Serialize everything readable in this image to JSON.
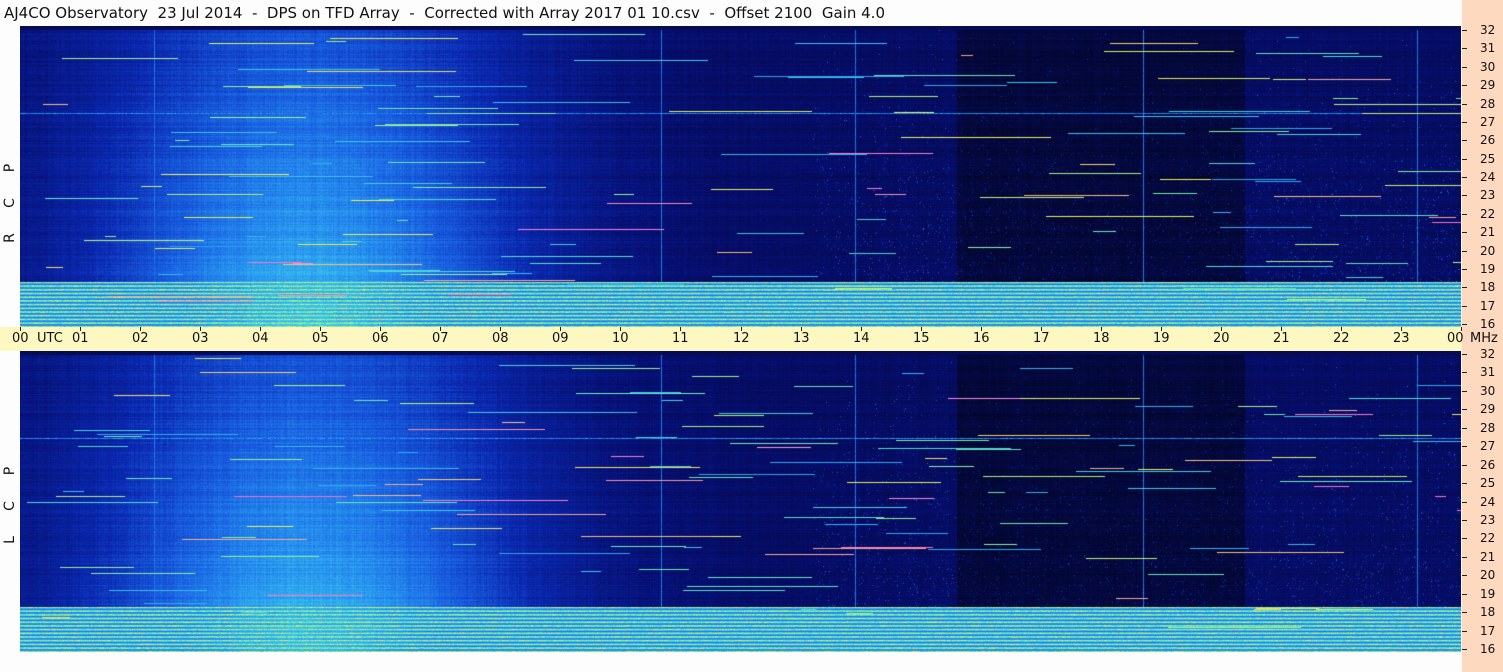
{
  "title": "AJ4CO Observatory  23 Jul 2014  -  DPS on TFD Array  -  Corrected with Array 2017 01 10.csv  -  Offset 2100  Gain 4.0",
  "panels": [
    {
      "id": "rcp",
      "letters": [
        "R",
        "C",
        "P"
      ]
    },
    {
      "id": "lcp",
      "letters": [
        "L",
        "C",
        "P"
      ]
    }
  ],
  "time_axis": {
    "utc_label": "UTC",
    "mhz_label": "MHz",
    "ticks": [
      "00",
      "01",
      "02",
      "03",
      "04",
      "05",
      "06",
      "07",
      "08",
      "09",
      "10",
      "11",
      "12",
      "13",
      "14",
      "15",
      "16",
      "17",
      "18",
      "19",
      "20",
      "21",
      "22",
      "23",
      "00"
    ]
  },
  "frequency_axis": {
    "ticks": [
      "32",
      "31",
      "30",
      "29",
      "28",
      "27",
      "26",
      "25",
      "24",
      "23",
      "22",
      "21",
      "20",
      "19",
      "18",
      "17",
      "16"
    ]
  },
  "colors": {
    "axis_band": "#fdf8c2",
    "right_strip": "#fdd9c0",
    "spectrogram_dark": "#05082e",
    "spectrogram_mid": "#0b2f9c",
    "spectrogram_bright": "#2f9be6"
  }
}
